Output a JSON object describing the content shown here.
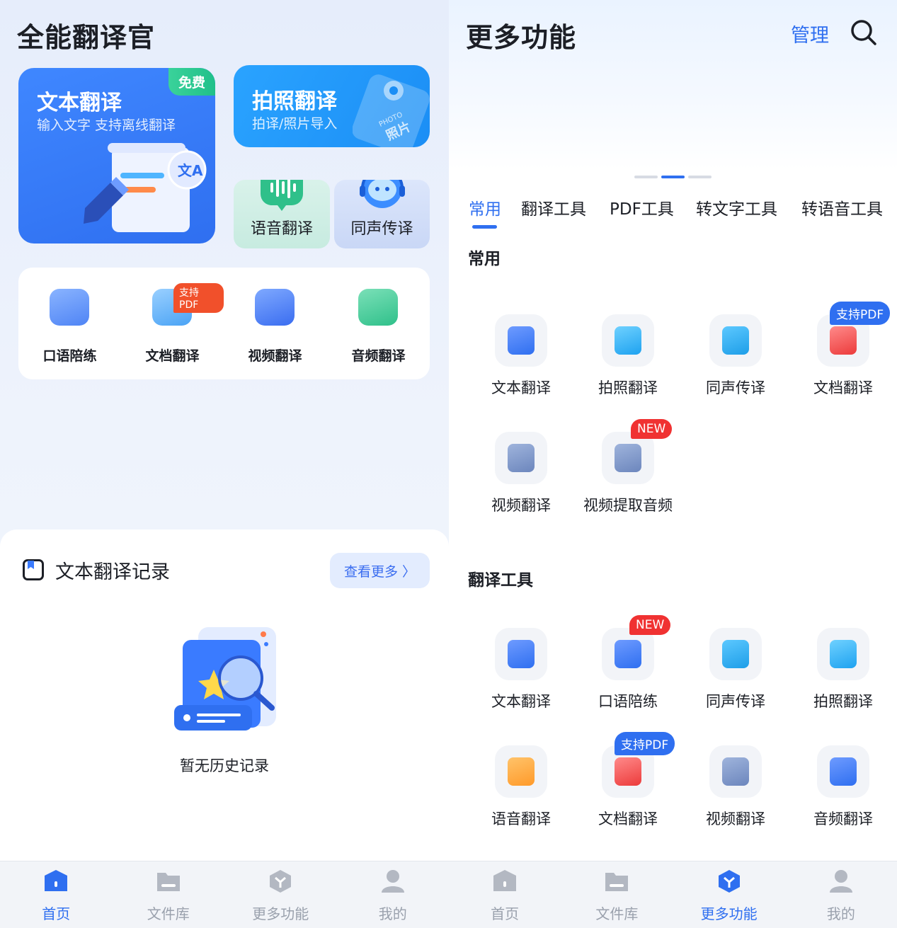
{
  "left": {
    "title": "全能翻译官",
    "text_card": {
      "title": "文本翻译",
      "subtitle": "输入文字 支持离线翻译",
      "badge": "免费"
    },
    "photo_card": {
      "title": "拍照翻译",
      "subtitle": "拍译/照片导入",
      "deco1": "PHOTO",
      "deco2": "照片"
    },
    "voice_card": {
      "label": "语音翻译"
    },
    "simul_card": {
      "label": "同声传译"
    },
    "tools": [
      {
        "label": "口语陪练"
      },
      {
        "label": "文档翻译",
        "badge": "支持PDF"
      },
      {
        "label": "视频翻译"
      },
      {
        "label": "音频翻译"
      }
    ],
    "records": {
      "title": "文本翻译记录",
      "more": "查看更多 〉",
      "empty": "暂无历史记录"
    }
  },
  "right": {
    "title": "更多功能",
    "manage": "管理",
    "tabs": [
      "常用",
      "翻译工具",
      "PDF工具",
      "转文字工具",
      "转语音工具"
    ],
    "sections": [
      {
        "title": "常用",
        "items": [
          {
            "label": "文本翻译"
          },
          {
            "label": "拍照翻译"
          },
          {
            "label": "同声传译"
          },
          {
            "label": "文档翻译",
            "tag": "支持PDF"
          },
          {
            "label": "视频翻译"
          },
          {
            "label": "视频提取音频",
            "tag": "NEW"
          }
        ]
      },
      {
        "title": "翻译工具",
        "items": [
          {
            "label": "文本翻译"
          },
          {
            "label": "口语陪练",
            "tag": "NEW"
          },
          {
            "label": "同声传译"
          },
          {
            "label": "拍照翻译"
          },
          {
            "label": "语音翻译"
          },
          {
            "label": "文档翻译",
            "tag": "支持PDF"
          },
          {
            "label": "视频翻译"
          },
          {
            "label": "音频翻译"
          }
        ]
      }
    ]
  },
  "nav": [
    "首页",
    "文件库",
    "更多功能",
    "我的"
  ],
  "colors": {
    "accent": "#2f6ff0",
    "new": "#f03232",
    "free": "#20c08a",
    "pdf_badge": "#f1502b"
  }
}
